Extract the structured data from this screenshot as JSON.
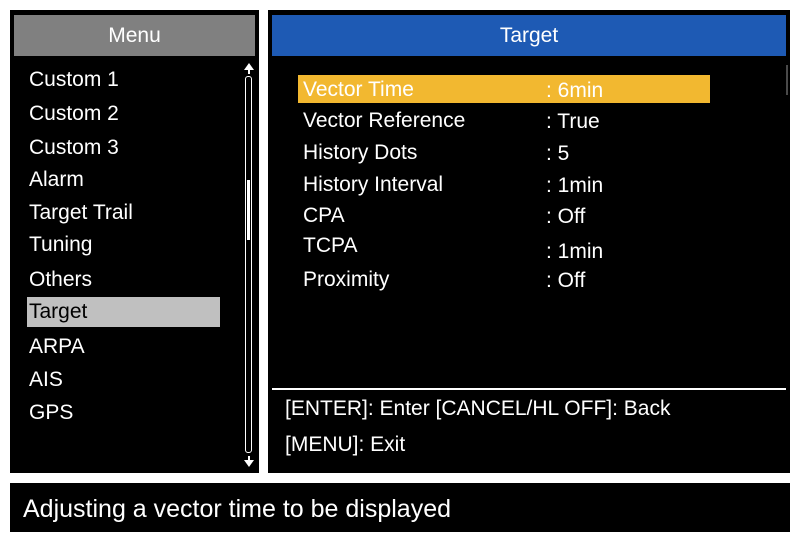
{
  "menu": {
    "title": "Menu",
    "items": [
      {
        "label": "Custom 1"
      },
      {
        "label": "Custom 2"
      },
      {
        "label": "Custom 3"
      },
      {
        "label": "Alarm"
      },
      {
        "label": "Target  Trail"
      },
      {
        "label": "Tuning"
      },
      {
        "label": "Others"
      },
      {
        "label": "Target",
        "selected": true
      },
      {
        "label": "ARPA"
      },
      {
        "label": "AIS"
      },
      {
        "label": "GPS"
      }
    ]
  },
  "target_panel": {
    "title": "Target",
    "settings": [
      {
        "name": "Vector Time",
        "value": ": 6min",
        "selected": true
      },
      {
        "name": "Vector Reference",
        "value": ": True"
      },
      {
        "name": "History Dots",
        "value": ": 5"
      },
      {
        "name": "History Interval",
        "value": ": 1min"
      },
      {
        "name": "CPA",
        "value": ": Off"
      },
      {
        "name": "TCPA",
        "value": ": 1min"
      },
      {
        "name": "Proximity",
        "value": ": Off"
      }
    ],
    "help": {
      "line1": "[ENTER]: Enter [CANCEL/HL OFF]: Back",
      "line2": "[MENU]: Exit"
    }
  },
  "status": {
    "text": "Adjusting a vector time to be displayed"
  },
  "colors": {
    "menu_header": "#808080",
    "target_header": "#1e5ab4",
    "highlight": "#f2b830",
    "menu_selected": "#c0c0c0",
    "background": "#000000"
  }
}
